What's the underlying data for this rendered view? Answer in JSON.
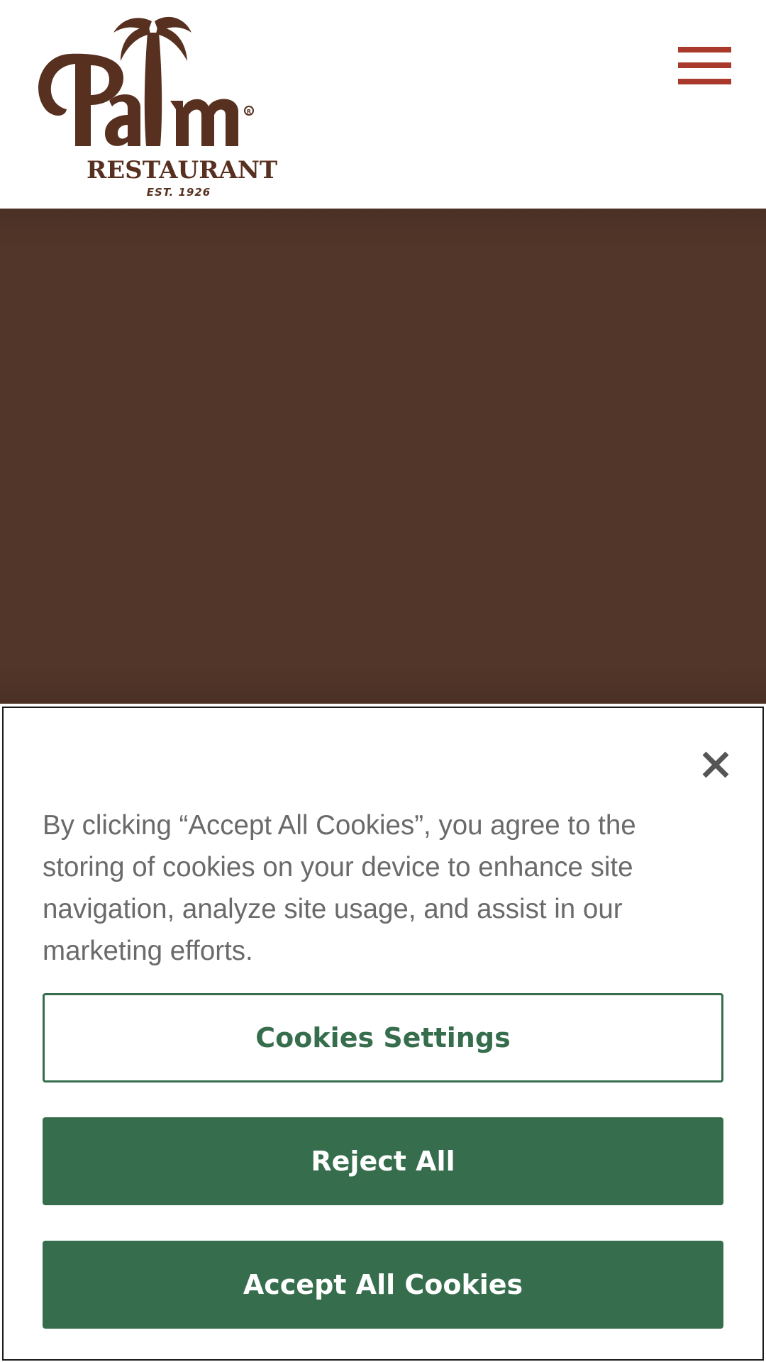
{
  "brand": {
    "logo_title": "Palm",
    "logo_subtitle": "RESTAURANT",
    "logo_est": "EST. 1926"
  },
  "header": {
    "menu_icon": "hamburger-menu-icon"
  },
  "cookie_banner": {
    "close_icon": "close-icon",
    "message": "By clicking “Accept All Cookies”, you agree to the storing of cookies on your device to enhance site navigation, analyze site usage, and assist in our marketing efforts.",
    "settings_label": "Cookies Settings",
    "reject_label": "Reject All",
    "accept_label": "Accept All Cookies"
  },
  "colors": {
    "brand_brown": "#57301f",
    "menu_red": "#a93a2b",
    "hero_brown": "#523629",
    "button_green": "#366e4d"
  }
}
